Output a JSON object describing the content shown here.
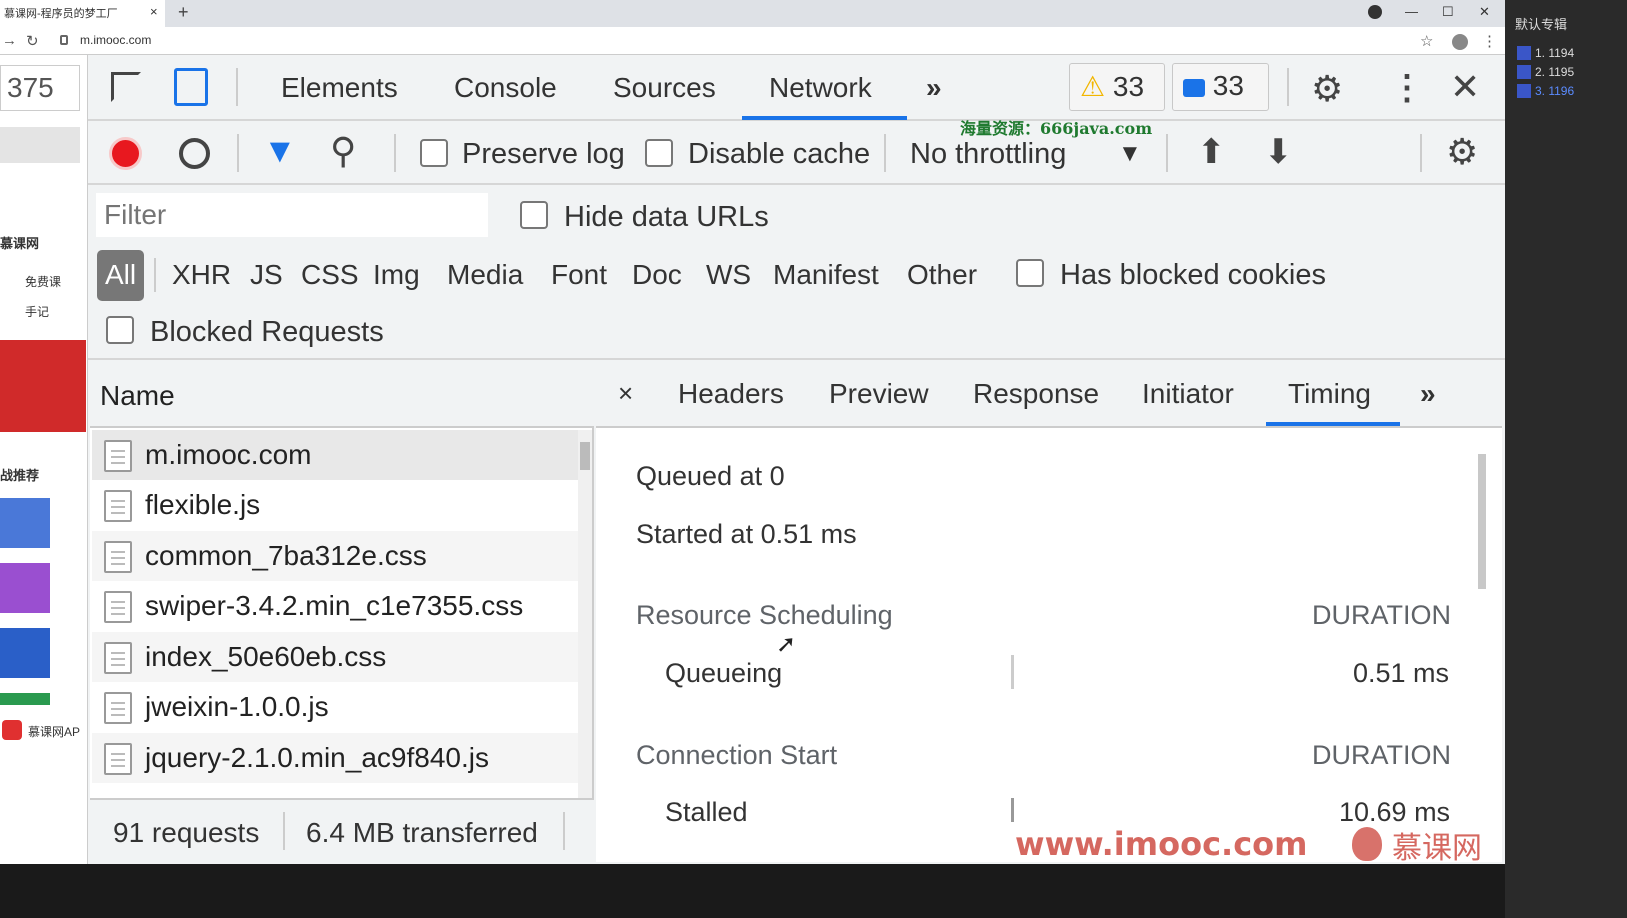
{
  "browser": {
    "tab_title": "慕课网-程序员的梦工厂",
    "tab_close": "×",
    "new_tab": "+",
    "url": "m.imooc.com",
    "window_controls": [
      "—",
      "☐",
      "✕"
    ]
  },
  "left_page": {
    "zoom_value": "375",
    "logo_text": "慕课网",
    "nav_items": [
      "免费课",
      "手记"
    ],
    "section_title": "战推荐",
    "bottom_app": "慕课网AP"
  },
  "devtools": {
    "tabs": [
      "Elements",
      "Console",
      "Sources",
      "Network"
    ],
    "more_tabs": "»",
    "warnings_count": "33",
    "messages_count": "33",
    "toolbar": {
      "preserve_log": "Preserve log",
      "disable_cache": "Disable cache",
      "throttling": "No throttling"
    },
    "filter": {
      "placeholder": "Filter",
      "hide_data_urls": "Hide data URLs",
      "types": [
        "All",
        "XHR",
        "JS",
        "CSS",
        "Img",
        "Media",
        "Font",
        "Doc",
        "WS",
        "Manifest",
        "Other"
      ],
      "has_blocked_cookies": "Has blocked cookies",
      "blocked_requests": "Blocked Requests"
    },
    "request_list": {
      "header": "Name",
      "items": [
        "m.imooc.com",
        "flexible.js",
        "common_7ba312e.css",
        "swiper-3.4.2.min_c1e7355.css",
        "index_50e60eb.css",
        "jweixin-1.0.0.js",
        "jquery-2.1.0.min_ac9f840.js"
      ],
      "requests": "91 requests",
      "transferred": "6.4 MB transferred"
    },
    "detail": {
      "close": "×",
      "tabs": [
        "Headers",
        "Preview",
        "Response",
        "Initiator",
        "Timing"
      ],
      "more": "»",
      "queued_at": "Queued at 0",
      "started_at": "Started at 0.51 ms",
      "sections": [
        {
          "title": "Resource Scheduling",
          "duration_label": "DURATION",
          "row_label": "Queueing",
          "row_value": "0.51 ms"
        },
        {
          "title": "Connection Start",
          "duration_label": "DURATION",
          "row_label": "Stalled",
          "row_value": "10.69 ms"
        }
      ]
    }
  },
  "watermarks": {
    "top": "海量资源：666java.com",
    "bottom": "www.imooc.com",
    "logo": "慕课网"
  },
  "right_panel": {
    "title": "默认专辑",
    "items": [
      "1. 1194",
      "2. 1195",
      "3. 1196"
    ]
  },
  "colors": {
    "accent_blue": "#1a73e8",
    "record_red": "#e8181f",
    "filter_blue": "#1a73e8",
    "warning_yellow": "#f2b600"
  }
}
